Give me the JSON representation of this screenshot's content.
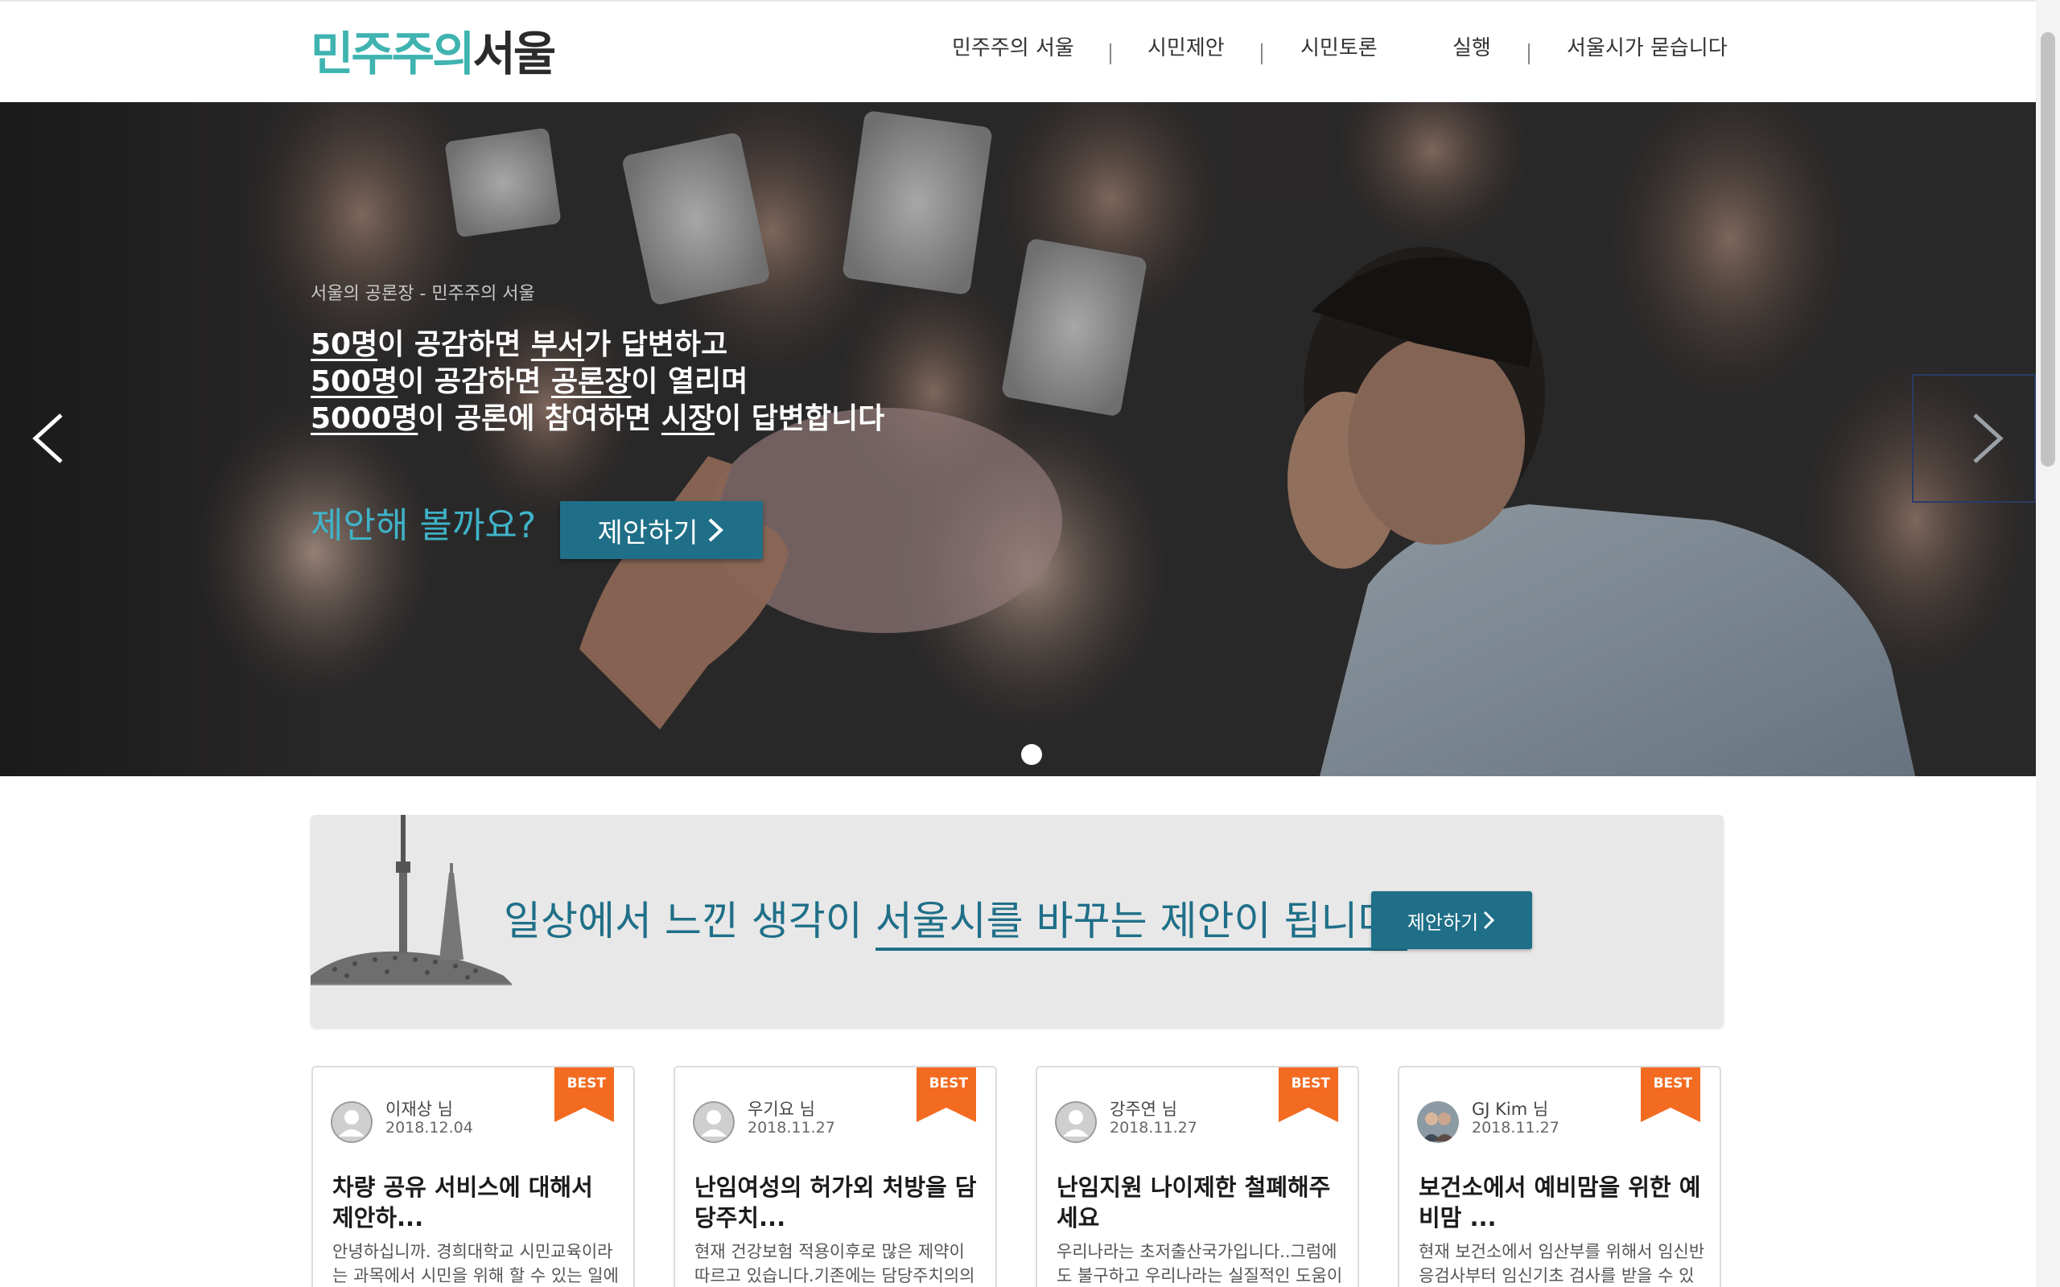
{
  "header": {
    "logo_part1": "민주주의",
    "logo_part2": "서울",
    "nav": [
      "민주주의 서울",
      "시민제안",
      "시민토론",
      "실행",
      "서울시가 묻습니다"
    ]
  },
  "hero": {
    "caption": "서울의 공론장 - 민주주의 서울",
    "line1_u1": "50명",
    "line1_t1": "이 공감하면 ",
    "line1_u2": "부서",
    "line1_t2": "가 답변하고",
    "line2_u1": "500명",
    "line2_t1": "이 공감하면 ",
    "line2_u2": "공론장",
    "line2_t2": "이 열리며",
    "line3_u1": "5000명",
    "line3_t1": "이 공론에 참여하면 ",
    "line3_u2": "시장",
    "line3_t2": "이 답변합니다",
    "question": "제안해 볼까요?",
    "button": "제안하기",
    "prev_icon": "chevron-left-icon",
    "next_icon": "chevron-right-icon"
  },
  "banner": {
    "text_plain": "일상에서 느낀 생각이 ",
    "text_underlined": "서울시를 바꾸는 제안이 됩니다.",
    "button": "제안하기"
  },
  "cards": [
    {
      "badge": "BEST",
      "author": "이재상 님",
      "date": "2018.12.04",
      "title": "차량 공유 서비스에 대해서 제안하...",
      "body": "안녕하십니까. 경희대학교 시민교육이라는 과목에서 시민을 위해 할 수 있는 일에"
    },
    {
      "badge": "BEST",
      "author": "우기요 님",
      "date": "2018.11.27",
      "title": "난임여성의 허가외 처방을 담당주치...",
      "body": "현재 건강보험 적용이후로 많은 제약이 따르고 있습니다.기존에는 담당주치의의"
    },
    {
      "badge": "BEST",
      "author": "강주연 님",
      "date": "2018.11.27",
      "title": "난임지원 나이제한 철폐해주세요",
      "body": "우리나라는 초저출산국가입니다..그럼에도 불구하고 우리나라는 실질적인 도움이"
    },
    {
      "badge": "BEST",
      "author": "GJ Kim 님",
      "date": "2018.11.27",
      "title": "보건소에서 예비맘을 위한 예비맘 ...",
      "body": "현재 보건소에서 임산부를 위해서 임신반응검사부터 임신기초 검사를 받을 수 있"
    }
  ],
  "colors": {
    "brand_teal": "#3fb3b0",
    "button_blue": "#1f6f88",
    "best_orange": "#f26b21"
  }
}
